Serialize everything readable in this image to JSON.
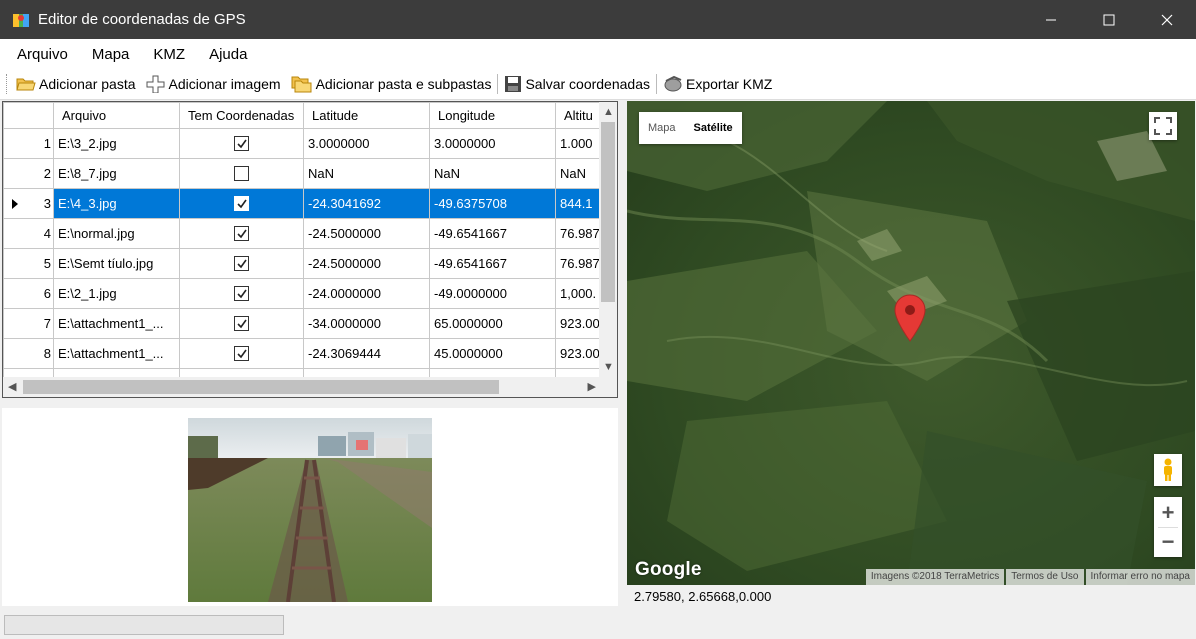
{
  "window": {
    "title": "Editor de coordenadas de GPS"
  },
  "menu": [
    "Arquivo",
    "Mapa",
    "KMZ",
    "Ajuda"
  ],
  "toolbar": {
    "add_folder": "Adicionar pasta",
    "add_image": "Adicionar imagem",
    "add_folder_sub": "Adicionar pasta e subpastas",
    "save_coords": "Salvar coordenadas",
    "export_kmz": "Exportar KMZ"
  },
  "grid": {
    "columns": [
      "Arquivo",
      "Tem Coordenadas",
      "Latitude",
      "Longitude",
      "Altitu"
    ],
    "selected_row": 3,
    "rows": [
      {
        "num": "1",
        "file": "E:\\3_2.jpg",
        "has_coords": true,
        "lat": "3.0000000",
        "lon": "3.0000000",
        "alt": "1.000"
      },
      {
        "num": "2",
        "file": "E:\\8_7.jpg",
        "has_coords": false,
        "lat": "NaN",
        "lon": "NaN",
        "alt": "NaN"
      },
      {
        "num": "3",
        "file": "E:\\4_3.jpg",
        "has_coords": true,
        "lat": "-24.3041692",
        "lon": "-49.6375708",
        "alt": "844.1"
      },
      {
        "num": "4",
        "file": "E:\\normal.jpg",
        "has_coords": true,
        "lat": "-24.5000000",
        "lon": "-49.6541667",
        "alt": "76.987"
      },
      {
        "num": "5",
        "file": "E:\\Semt tíulo.jpg",
        "has_coords": true,
        "lat": "-24.5000000",
        "lon": "-49.6541667",
        "alt": "76.987"
      },
      {
        "num": "6",
        "file": "E:\\2_1.jpg",
        "has_coords": true,
        "lat": "-24.0000000",
        "lon": "-49.0000000",
        "alt": "1,000."
      },
      {
        "num": "7",
        "file": "E:\\attachment1_...",
        "has_coords": true,
        "lat": "-34.0000000",
        "lon": "65.0000000",
        "alt": "923.00"
      },
      {
        "num": "8",
        "file": "E:\\attachment1_...",
        "has_coords": true,
        "lat": "-24.3069444",
        "lon": "45.0000000",
        "alt": "923.00"
      }
    ]
  },
  "map": {
    "type_map": "Mapa",
    "type_satellite": "Satélite",
    "google_logo": "Google",
    "attribution": [
      "Imagens ©2018 TerraMetrics",
      "Termos de Uso",
      "Informar erro no mapa"
    ],
    "zoom_in": "+",
    "zoom_out": "−",
    "marker_color": "#e53935"
  },
  "status": {
    "coords": "2.79580, 2.65668,0.000"
  },
  "colors": {
    "selection": "#0078d7",
    "titlebar": "#3c3c3c"
  }
}
